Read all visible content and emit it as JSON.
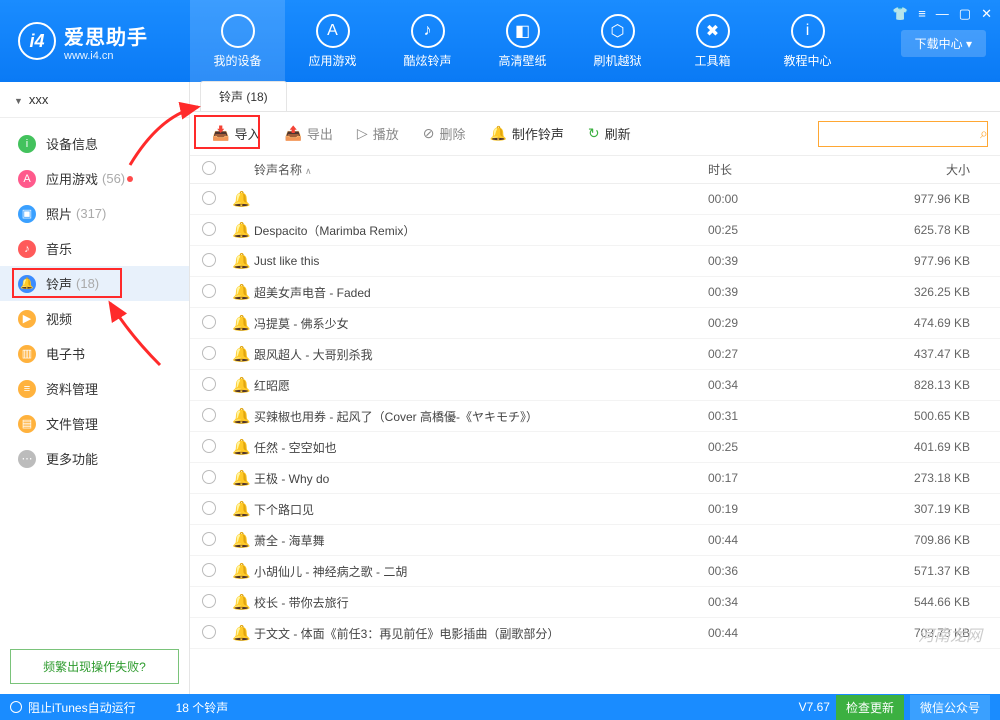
{
  "header": {
    "brand_cn": "爱思助手",
    "brand_url": "www.i4.cn",
    "nav": [
      {
        "label": "我的设备",
        "icon": ""
      },
      {
        "label": "应用游戏",
        "icon": "A"
      },
      {
        "label": "酷炫铃声",
        "icon": "♪"
      },
      {
        "label": "高清壁纸",
        "icon": "◧"
      },
      {
        "label": "刷机越狱",
        "icon": "⬡"
      },
      {
        "label": "工具箱",
        "icon": "✖"
      },
      {
        "label": "教程中心",
        "icon": "i"
      }
    ],
    "download_center": "下载中心 ▾"
  },
  "sidebar": {
    "device": "xxx",
    "items": [
      {
        "label": "设备信息",
        "color": "#43c25d",
        "glyph": "i"
      },
      {
        "label": "应用游戏",
        "count": "(56)",
        "dot": true,
        "color": "#ff5a8c",
        "glyph": "A"
      },
      {
        "label": "照片",
        "count": "(317)",
        "color": "#3aa0ff",
        "glyph": "▣"
      },
      {
        "label": "音乐",
        "color": "#ff5a5a",
        "glyph": "♪"
      },
      {
        "label": "铃声",
        "count": "(18)",
        "active": true,
        "color": "#3b8cff",
        "glyph": "🔔"
      },
      {
        "label": "视频",
        "color": "#ffb23d",
        "glyph": "▶"
      },
      {
        "label": "电子书",
        "color": "#ffb23d",
        "glyph": "▥"
      },
      {
        "label": "资料管理",
        "color": "#ffb23d",
        "glyph": "≡"
      },
      {
        "label": "文件管理",
        "color": "#ffb23d",
        "glyph": "▤"
      },
      {
        "label": "更多功能",
        "color": "#bcbcbc",
        "glyph": "⋯"
      }
    ],
    "help": "频繁出现操作失败?"
  },
  "main": {
    "tab": "铃声 (18)",
    "toolbar": {
      "import": "导入",
      "export": "导出",
      "play": "播放",
      "delete": "删除",
      "make": "制作铃声",
      "refresh": "刷新"
    },
    "columns": {
      "name": "铃声名称",
      "dur": "时长",
      "size": "大小"
    },
    "rows": [
      {
        "name": "",
        "dur": "00:00",
        "size": "977.96 KB"
      },
      {
        "name": "Despacito（Marimba Remix）",
        "dur": "00:25",
        "size": "625.78 KB"
      },
      {
        "name": "Just like this",
        "dur": "00:39",
        "size": "977.96 KB"
      },
      {
        "name": "超美女声电音 - Faded",
        "dur": "00:39",
        "size": "326.25 KB"
      },
      {
        "name": "冯提莫 - 佛系少女",
        "dur": "00:29",
        "size": "474.69 KB"
      },
      {
        "name": "跟风超人 - 大哥别杀我",
        "dur": "00:27",
        "size": "437.47 KB"
      },
      {
        "name": "红昭愿",
        "dur": "00:34",
        "size": "828.13 KB"
      },
      {
        "name": "买辣椒也用券 - 起风了（Cover 高橋優-《ヤキモチ》）",
        "dur": "00:31",
        "size": "500.65 KB"
      },
      {
        "name": "任然 - 空空如也",
        "dur": "00:25",
        "size": "401.69 KB"
      },
      {
        "name": "王极 - Why do",
        "dur": "00:17",
        "size": "273.18 KB"
      },
      {
        "name": "下个路口见",
        "dur": "00:19",
        "size": "307.19 KB"
      },
      {
        "name": "萧全 - 海草舞",
        "dur": "00:44",
        "size": "709.86 KB"
      },
      {
        "name": "小胡仙儿 - 神经病之歌 - 二胡",
        "dur": "00:36",
        "size": "571.37 KB"
      },
      {
        "name": "校长 - 带你去旅行",
        "dur": "00:34",
        "size": "544.66 KB"
      },
      {
        "name": "于文文 - 体面《前任3：再见前任》电影插曲（副歌部分）",
        "dur": "00:44",
        "size": "703.73 KB"
      }
    ]
  },
  "footer": {
    "itunes": "阻止iTunes自动运行",
    "count": "18 个铃声",
    "version": "V7.67",
    "update": "检查更新",
    "wechat": "微信公众号"
  },
  "watermark": "河南龙网"
}
